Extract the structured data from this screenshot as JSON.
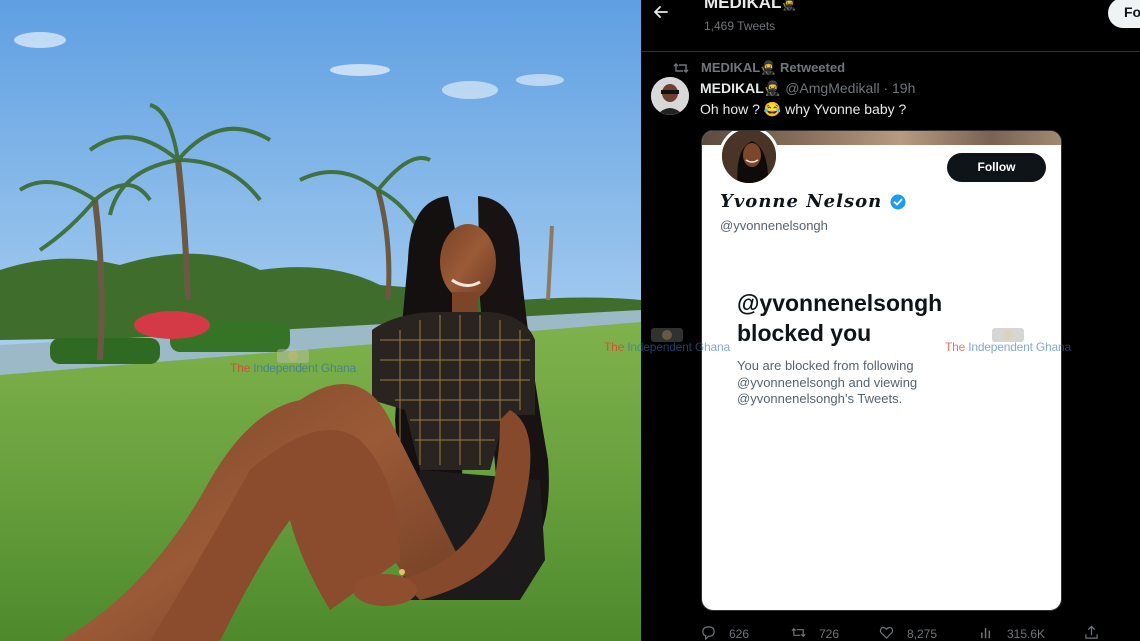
{
  "watermark": {
    "brand_part1": "The ",
    "brand_part2": "Independent Ghana"
  },
  "twitter": {
    "profile": {
      "name": "MEDIKAL",
      "name_emoji": "🥷",
      "tweet_count": "1,469 Tweets",
      "follow_label": "Fo"
    },
    "retweet": {
      "label": "MEDIKAL🥷 Retweeted"
    },
    "tweet": {
      "author": "MEDIKAL🥷",
      "handle_time": "@AmgMedikall · 19h",
      "text": "Oh how ? 😂 why Yvonne baby ?"
    },
    "card": {
      "follow_label": "Follow",
      "display_name": "Yvonne Nelson",
      "handle": "@yvonnenelsongh",
      "title_line1": "@yvonnenelsongh",
      "title_line2": "blocked you",
      "description": "You are blocked from following @yvonnenelsongh and viewing @yvonnenelsongh’s Tweets."
    },
    "actions": {
      "replies": "626",
      "retweets": "726",
      "likes": "8,275",
      "views": "315.6K"
    }
  },
  "colors": {
    "accent_blue": "#1d9bf0",
    "bg": "#000000",
    "muted": "#71767b"
  }
}
